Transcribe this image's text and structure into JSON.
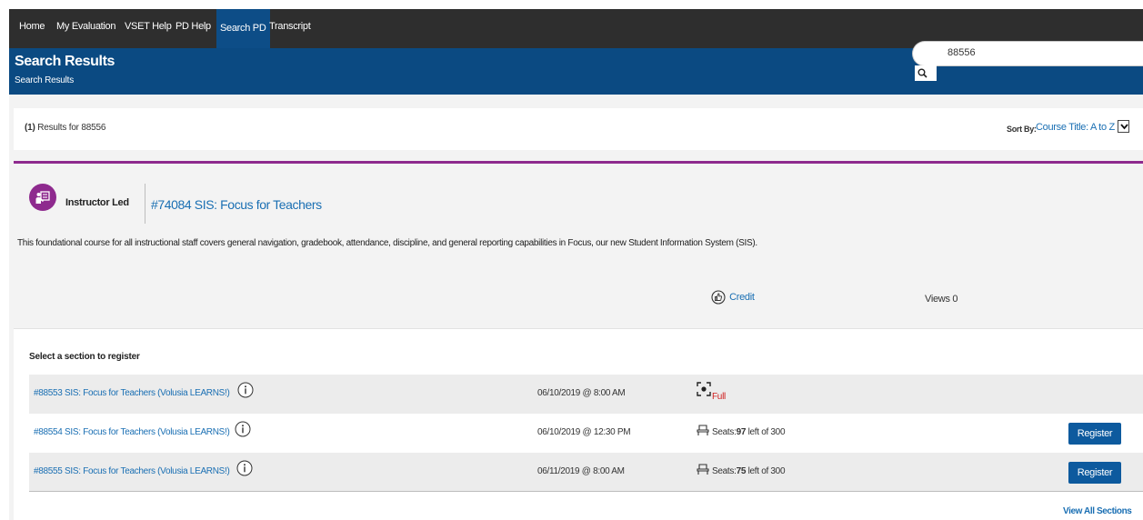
{
  "nav": {
    "items": [
      {
        "label": "Home",
        "active": false
      },
      {
        "label": "My Evaluation",
        "active": false
      },
      {
        "label": "VSET Help",
        "active": false
      },
      {
        "label": "PD Help",
        "active": false
      },
      {
        "label": "Search PD",
        "active": true
      },
      {
        "label": "Transcript",
        "active": false
      }
    ]
  },
  "banner": {
    "title": "Search Results",
    "subtitle": "Search Results"
  },
  "search": {
    "value": "88556",
    "button_icon": "search-icon"
  },
  "results": {
    "count": "(1)",
    "text": "Results for 88556",
    "sort_label": "Sort By:",
    "sort_value": "Course Title: A to Z"
  },
  "course": {
    "type_icon": "instructor-led-icon",
    "type": "Instructor Led",
    "title": "#74084 SIS: Focus for Teachers",
    "description": "This foundational course for all instructional staff covers general navigation, gradebook, attendance, discipline, and general reporting capabilities in Focus, our new Student Information System (SIS).",
    "credit_icon": "thumbs-up-icon",
    "credit_label": "Credit",
    "views": "Views 0"
  },
  "sections": {
    "heading": "Select a section to register",
    "rows": [
      {
        "title": "#88553 SIS: Focus for Teachers (Volusia LEARNS!)",
        "date": "06/10/2019 @ 8:00 AM",
        "status": "Full",
        "seats_label": "",
        "seats_available": "",
        "seats_of": "",
        "register_label": ""
      },
      {
        "title": "#88554 SIS: Focus for Teachers (Volusia LEARNS!)",
        "date": "06/10/2019 @ 12:30 PM",
        "status": "",
        "seats_label": "Seats:",
        "seats_available": "97",
        "seats_of": "left of 300",
        "register_label": "Register"
      },
      {
        "title": "#88555 SIS: Focus for Teachers (Volusia LEARNS!)",
        "date": "06/11/2019 @ 8:00 AM",
        "status": "",
        "seats_label": "Seats:",
        "seats_available": "75",
        "seats_of": "left of 300",
        "register_label": "Register"
      }
    ],
    "view_all": "View All Sections"
  },
  "colors": {
    "nav_bg": "#2e2e2e",
    "banner_bg": "#0b4a82",
    "active_tab": "#0d4d87",
    "accent_purple": "#8e2a8e",
    "link_blue": "#1a6fb3",
    "full_red": "#d02020",
    "button_blue": "#0d5a9e"
  }
}
